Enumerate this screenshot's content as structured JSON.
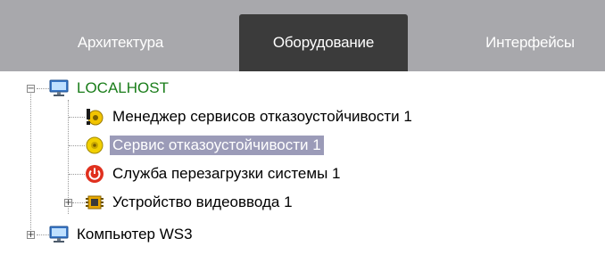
{
  "tabs": [
    {
      "label": "Архитектура"
    },
    {
      "label": "Оборудование"
    },
    {
      "label": "Интерфейсы"
    }
  ],
  "tree": {
    "root": {
      "label": "LOCALHOST",
      "expanded": true
    },
    "children": [
      {
        "label": "Менеджер сервисов отказоустойчивости 1",
        "icon": "failover-manager-icon"
      },
      {
        "label": "Сервис отказоустойчивости 1",
        "icon": "failover-service-icon",
        "selected": true
      },
      {
        "label": "Служба перезагрузки системы 1",
        "icon": "power-icon"
      },
      {
        "label": "Устройство видеоввода 1",
        "icon": "video-capture-chip-icon",
        "expandable": true
      }
    ],
    "second_root": {
      "label": "Компьютер WS3",
      "expanded": false
    }
  },
  "colors": {
    "topbar": "#a8a8ac",
    "active_tab": "#3b3b3b",
    "selection": "#9b9bb8",
    "root_label": "#1a7d1a"
  }
}
